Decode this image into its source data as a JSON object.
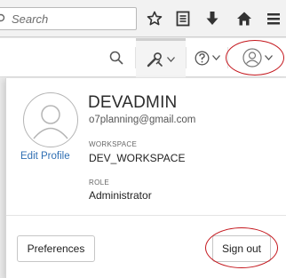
{
  "browser": {
    "search_placeholder": "Search",
    "icons": [
      "search-icon",
      "star-icon",
      "reading-list-icon",
      "download-icon",
      "home-icon"
    ]
  },
  "header": {
    "icons": [
      "search-icon",
      "tools-icon",
      "help-icon",
      "user-icon"
    ],
    "annotation_color": "#c4161c"
  },
  "profile": {
    "username": "DEVADMIN",
    "email": "o7planning@gmail.com",
    "edit_profile_label": "Edit Profile",
    "workspace_label": "WORKSPACE",
    "workspace_value": "DEV_WORKSPACE",
    "role_label": "ROLE",
    "role_value": "Administrator"
  },
  "footer": {
    "preferences_label": "Preferences",
    "signout_label": "Sign out"
  }
}
